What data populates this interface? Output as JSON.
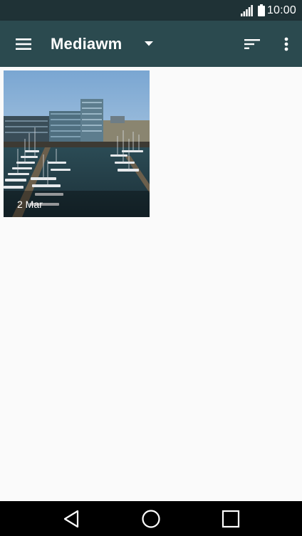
{
  "status_bar": {
    "time": "10:00",
    "icons": [
      "signal-icon",
      "battery-icon"
    ]
  },
  "app_bar": {
    "title": "Mediawm",
    "icons": [
      "menu-icon",
      "dropdown-arrow-icon",
      "sort-icon",
      "more-vert-icon"
    ]
  },
  "gallery": {
    "items": [
      {
        "date": "2 Mar"
      }
    ]
  },
  "nav_bar": {
    "icons": [
      "back-icon",
      "home-icon",
      "recents-icon"
    ]
  },
  "colors": {
    "status_bar": "#1f3236",
    "app_bar": "#2b4a4f",
    "background": "#fafafa",
    "nav_bar": "#000000"
  }
}
